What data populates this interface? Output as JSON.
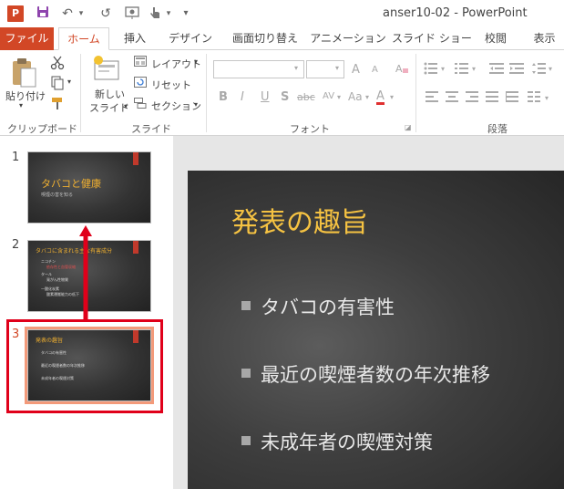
{
  "window": {
    "title": "anser10-02 - PowerPoint",
    "app_icon": "P"
  },
  "qat": {
    "undo_icon": "↶",
    "redo_icon": "↺",
    "dropdown_icon": "▾"
  },
  "tabs": [
    "ファイル",
    "ホーム",
    "挿入",
    "デザイン",
    "画面切り替え",
    "アニメーション",
    "スライド ショー",
    "校閲",
    "表示"
  ],
  "ribbon": {
    "clipboard": {
      "paste": "貼り付け",
      "label": "クリップボード"
    },
    "slides": {
      "new_slide": "新しい",
      "new_slide2": "スライド",
      "layout": "レイアウト",
      "reset": "リセット",
      "section": "セクション",
      "label": "スライド"
    },
    "font": {
      "label": "フォント",
      "bold": "B",
      "italic": "I",
      "underline": "U",
      "shadow": "S",
      "strike": "abc",
      "spacing": "AV",
      "case": "Aa",
      "grow": "A",
      "shrink": "A"
    },
    "paragraph": {
      "label": "段落"
    }
  },
  "thumbnails": [
    {
      "num": "1",
      "title": "タバコと健康",
      "subtitle": "喫煙の害を知る"
    },
    {
      "num": "2",
      "title": "タバコに含まれる主な有害成分",
      "lines": [
        "ニコチン",
        "依存性と血管収縮",
        "タール",
        "発がん性物質",
        "一酸化炭素",
        "酸素運搬能力の低下"
      ]
    },
    {
      "num": "3",
      "title": "発表の趣旨",
      "lines": [
        "タバコの有害性",
        "最近の喫煙者数の年次推移",
        "未成年者の喫煙対策"
      ]
    }
  ],
  "slide": {
    "title": "発表の趣旨",
    "bullets": [
      "タバコの有害性",
      "最近の喫煙者数の年次推移",
      "未成年者の喫煙対策"
    ]
  },
  "colors": {
    "accent": "#d24726",
    "highlight": "#e0001a",
    "slide_title": "#f5c242"
  }
}
